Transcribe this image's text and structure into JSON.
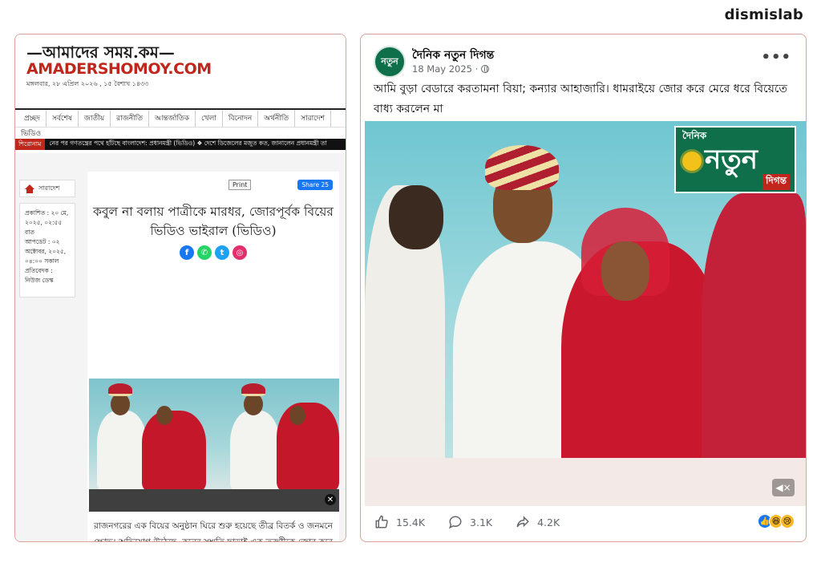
{
  "brand": "dismislab",
  "left": {
    "logo_bn": "—আমাদের সময়.কম—",
    "logo_en": "AMADERSHOMOY.COM",
    "date_line": "মঙ্গলবার, ২৮ এপ্রিল ২০২৬ , ১৫ বৈশাখ ১৪৩৩",
    "nav": [
      "প্রচ্ছদ",
      "সর্বশেষ",
      "জাতীয়",
      "রাজনীতি",
      "আন্তর্জাতিক",
      "খেলা",
      "বিনোদন",
      "অর্থনীতি",
      "সারাদেশ"
    ],
    "nav_row2": "ভিডিও",
    "ticker_label": "শিরোনাম",
    "ticker_text": "নের পর গণতন্ত্রের পথে হাঁটছে বাংলাদেশ: প্রধানমন্ত্রী (ভিডিও)  ❖  দেশে ডিজেলের মজুত কত, জানালেন প্রধানমন্ত্রী তা",
    "breadcrumb": "সারাদেশ",
    "meta": "প্রকাশিত : ২০ মে, ২০২৫, ০২:৫৫ রাত\nআপডেট : ০২ অক্টোবর, ২০২৫, ০৪:০০ সকাল\nপ্রতিবেদক : নিউজ ডেস্ক",
    "print_label": "Print",
    "share_label": "Share 25",
    "headline": "কবুল না বলায় পাত্রীকে মারধর, জোরপূর্বক বিয়ের ভিডিও ভাইরাল (ভিডিও)",
    "social": [
      {
        "icon": "facebook-icon",
        "glyph": "f",
        "color": "#1877f2"
      },
      {
        "icon": "whatsapp-icon",
        "glyph": "✆",
        "color": "#25d366"
      },
      {
        "icon": "twitter-icon",
        "glyph": "t",
        "color": "#1da1f2"
      },
      {
        "icon": "instagram-icon",
        "glyph": "◎",
        "color": "#e1306c"
      }
    ],
    "close_glyph": "✕",
    "body": "রাজনগরের এক বিয়ের অনুষ্ঠান ঘিরে শুরু হয়েছে তীব্র বিতর্ক ও জনমনে ক্ষোভ। অভিযোগ উঠেছে, কনের সম্মতি ছাড়াই এক তরুণীকে জোর করে বিয়ে দেওয়া হয়েছে। সামাজিক যোগাযোগমাধ্যমে ছড়িয়ে পড়া একটি ভিডিওতে দেখা যায়, ফাইমা মনি নামের এক তরুণী"
  },
  "right": {
    "avatar_text": "নতুন",
    "page_name": "দৈনিক নতুন দিগন্ত",
    "post_date": "18 May 2025 ·",
    "caption": "আমি বুড়া বেডারে করতামনা বিয়া; কন্যার আহাজারি। ধামরাইয়ে জোর করে মেরে ধরে বিয়েতে বাধ্য করলেন মা",
    "more_glyph": "•••",
    "image_logo_small": "দৈনিক",
    "image_logo_big": "নতুন",
    "image_logo_sub": "দিগন্ত",
    "mute_glyph": "◀×",
    "likes": "15.4K",
    "comments": "3.1K",
    "shares": "4.2K",
    "reaction_glyphs": [
      "👍",
      "😆",
      "😢"
    ]
  }
}
